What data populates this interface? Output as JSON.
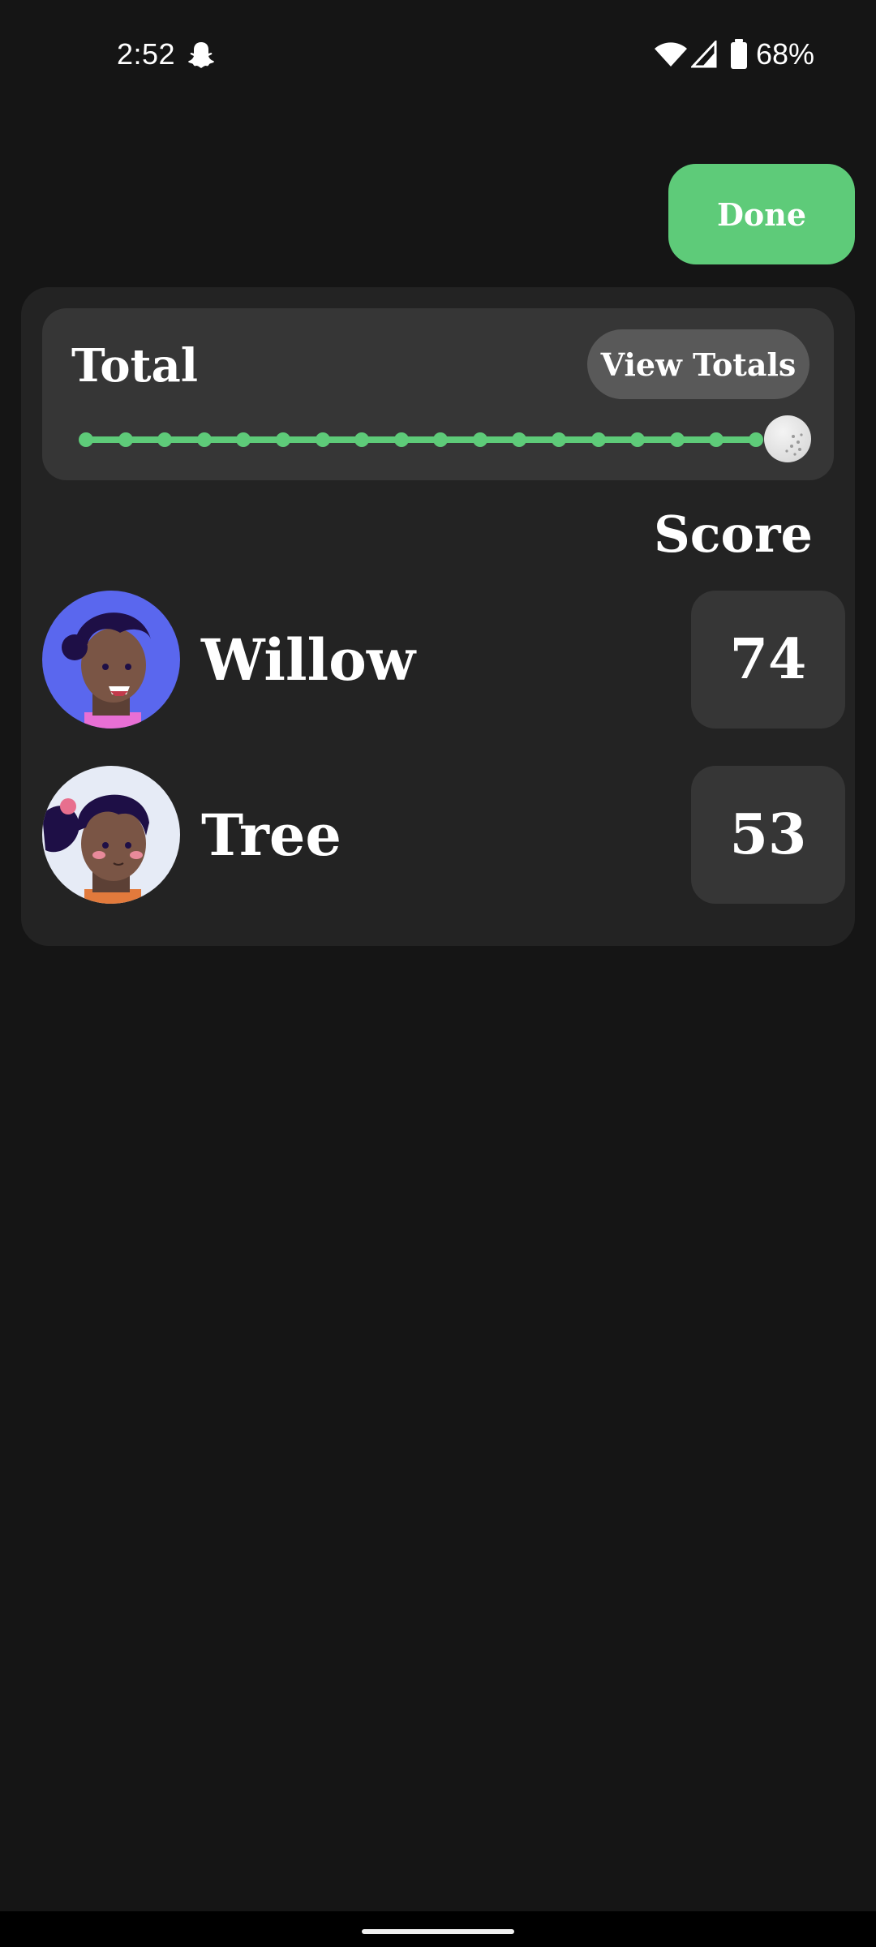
{
  "status_bar": {
    "time": "2:52",
    "battery": "68%",
    "icons": [
      "snapchat-icon",
      "wifi-icon",
      "signal-icon",
      "battery-icon"
    ]
  },
  "header": {
    "done_label": "Done"
  },
  "total_card": {
    "title": "Total",
    "view_totals_label": "View Totals",
    "progress_steps": 18,
    "progress_fraction": 1.0
  },
  "scores": {
    "header": "Score",
    "players": [
      {
        "name": "Willow",
        "score": "74",
        "avatar": "avatar-willow"
      },
      {
        "name": "Tree",
        "score": "53",
        "avatar": "avatar-tree"
      }
    ]
  },
  "colors": {
    "accent": "#5ecb79",
    "background": "#151515",
    "card": "#232323",
    "surface": "#363636"
  }
}
